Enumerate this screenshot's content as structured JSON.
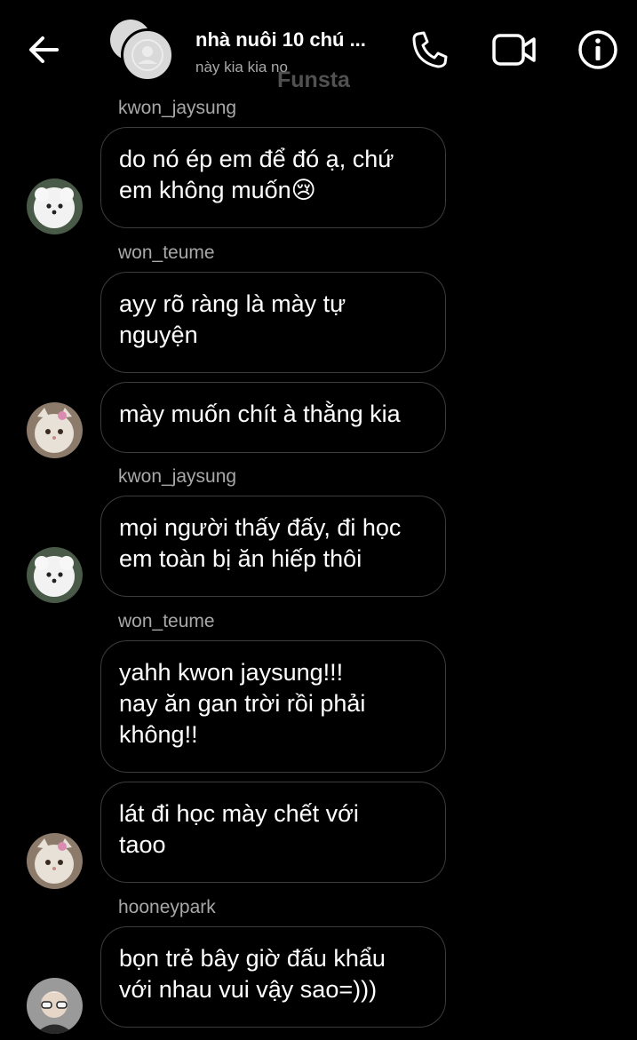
{
  "header": {
    "group_name": "nhà nuôi 10 chú ...",
    "subtitle": "này kia kia no",
    "watermark": "Funsta"
  },
  "icons": {
    "back": "arrow-left-icon",
    "call": "phone-icon",
    "video": "video-camera-icon",
    "info": "info-icon"
  },
  "messages": [
    {
      "sender": "kwon_jaysung",
      "bubbles": [
        "do nó ép em để đó ạ, chứ\nem không muốn😢"
      ]
    },
    {
      "sender": "won_teume",
      "bubbles": [
        "ayy rõ ràng là mày tự\nnguyện",
        "mày muốn chít à thằng kia"
      ]
    },
    {
      "sender": "kwon_jaysung",
      "bubbles": [
        "mọi người thấy đấy, đi học\nem toàn bị ăn hiếp thôi"
      ]
    },
    {
      "sender": "won_teume",
      "bubbles": [
        "yahh kwon jaysung!!!\nnay ăn gan trời rồi phải\nkhông!!",
        "lát đi học mày chết với\ntaoo"
      ]
    },
    {
      "sender": "hooneypark",
      "bubbles": [
        "bọn trẻ bây giờ đấu khẩu\nvới nhau vui vậy sao=)))"
      ]
    }
  ]
}
